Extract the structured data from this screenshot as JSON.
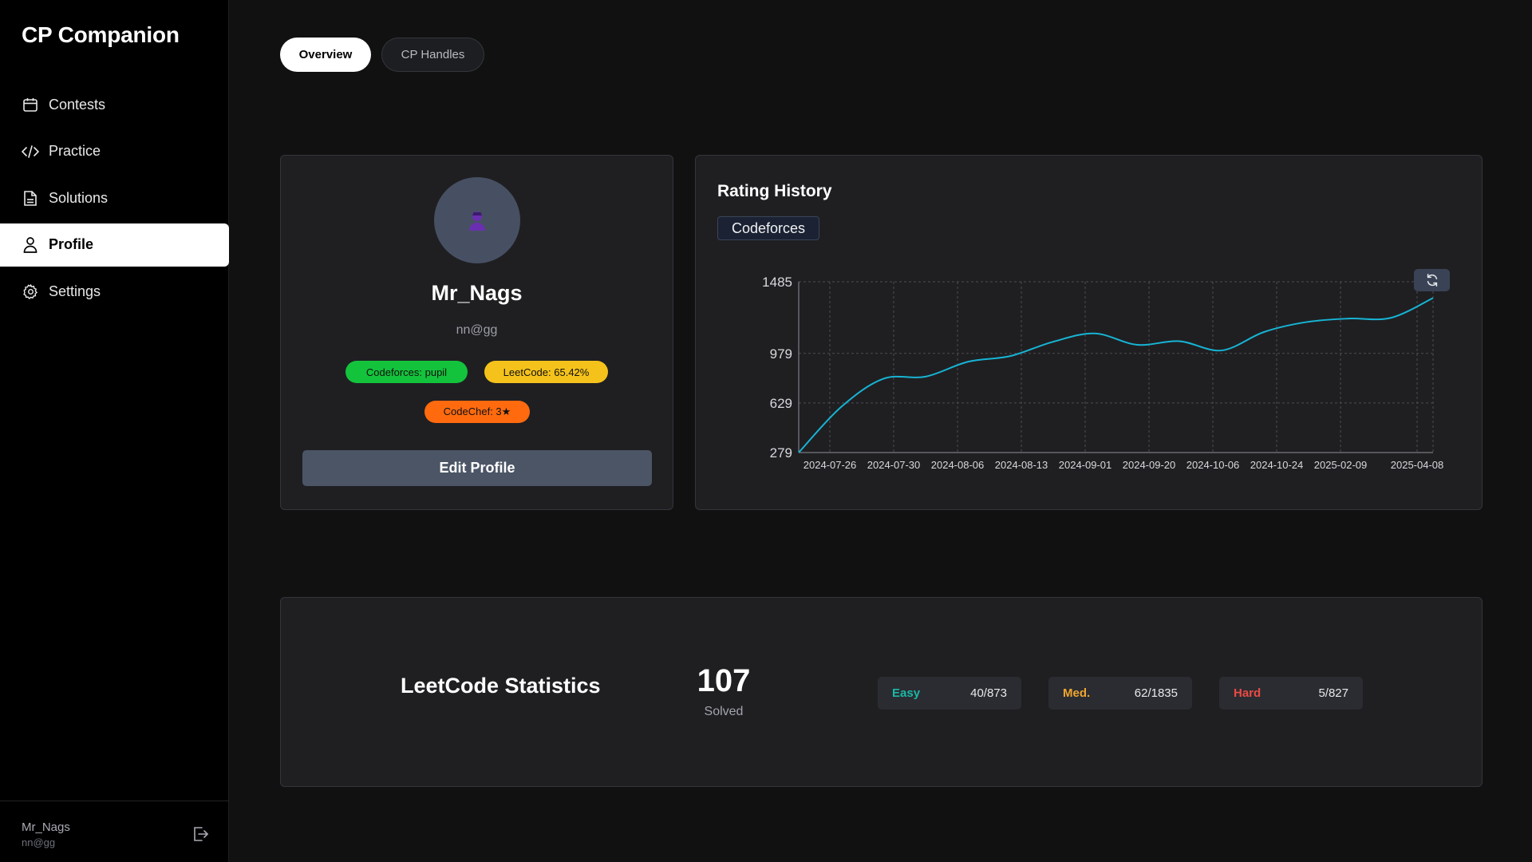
{
  "app": {
    "title": "CP Companion"
  },
  "sidebar": {
    "items": [
      {
        "label": "Contests",
        "icon": "calendar-icon",
        "active": false
      },
      {
        "label": "Practice",
        "icon": "code-icon",
        "active": false
      },
      {
        "label": "Solutions",
        "icon": "document-icon",
        "active": false
      },
      {
        "label": "Profile",
        "icon": "user-icon",
        "active": true
      },
      {
        "label": "Settings",
        "icon": "gear-icon",
        "active": false
      }
    ],
    "footer": {
      "name": "Mr_Nags",
      "email": "nn@gg",
      "logout_icon": "logout-icon"
    }
  },
  "tabs": [
    {
      "label": "Overview",
      "active": true
    },
    {
      "label": "CP Handles",
      "active": false
    }
  ],
  "profile": {
    "name": "Mr_Nags",
    "email": "nn@gg",
    "avatar_icon": "user-silhouette-icon",
    "badges": {
      "codeforces": "Codeforces: pupil",
      "leetcode": "LeetCode: 65.42%",
      "codechef": "CodeChef: 3★"
    },
    "edit_label": "Edit Profile"
  },
  "rating": {
    "title": "Rating History",
    "platform": "Codeforces",
    "refresh_icon": "refresh-icon"
  },
  "chart_data": {
    "type": "line",
    "title": "",
    "xlabel": "",
    "ylabel": "",
    "yticks": [
      279,
      629,
      979,
      1485
    ],
    "ylim": [
      279,
      1485
    ],
    "grid": true,
    "x": [
      "2024-07-26",
      "2024-07-30",
      "2024-08-06",
      "2024-08-13",
      "2024-09-01",
      "2024-09-20",
      "2024-10-06",
      "2024-10-24",
      "2025-02-09",
      "2025-04-08"
    ],
    "series": [
      {
        "color": "#17b4d4",
        "values": [
          279,
          600,
          800,
          815,
          920,
          960,
          1060,
          1120,
          1040,
          1065,
          1000,
          1130,
          1200,
          1225,
          1230,
          1370
        ]
      }
    ]
  },
  "leetcode": {
    "title": "LeetCode Statistics",
    "solved": "107",
    "solved_label": "Solved",
    "easy": {
      "label": "Easy",
      "value": "40/873",
      "color": "#19b8a6"
    },
    "medium": {
      "label": "Med.",
      "value": "62/1835",
      "color": "#f0a531"
    },
    "hard": {
      "label": "Hard",
      "value": "5/827",
      "color": "#eb4a44"
    }
  }
}
